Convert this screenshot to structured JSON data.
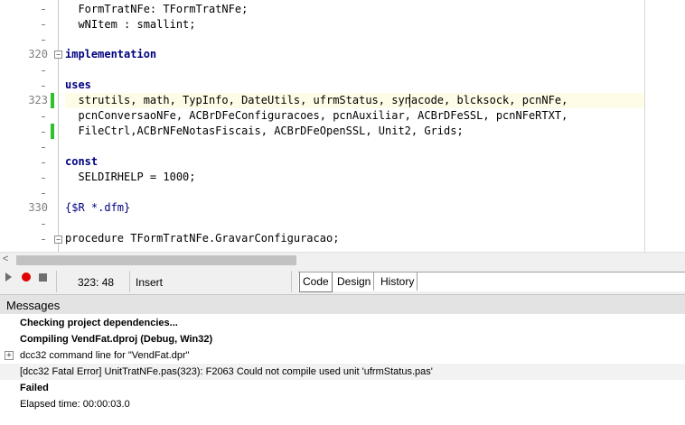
{
  "editor": {
    "lines": [
      {
        "num": "",
        "text": "  FormTratNFe: TFormTratNFe;"
      },
      {
        "num": "",
        "text": "  wNItem : smallint;"
      },
      {
        "num": "",
        "text": ""
      },
      {
        "num": "320",
        "text": "implementation"
      },
      {
        "num": "",
        "text": ""
      },
      {
        "num": "",
        "text": "uses"
      },
      {
        "num": "323",
        "text": "  strutils, math, TypInfo, DateUtils, ufrmStatus, synacode, blcksock, pcnNFe,"
      },
      {
        "num": "",
        "text": "  pcnConversaoNFe, ACBrDFeConfiguracoes, pcnAuxiliar, ACBrDFeSSL, pcnNFeRTXT,"
      },
      {
        "num": "",
        "text": "  FileCtrl,ACBrNFeNotasFiscais, ACBrDFeOpenSSL, Unit2, Grids;"
      },
      {
        "num": "",
        "text": ""
      },
      {
        "num": "",
        "text": "const"
      },
      {
        "num": "",
        "text": "  SELDIRHELP = 1000;"
      },
      {
        "num": "",
        "text": ""
      },
      {
        "num": "330",
        "text": "{$R *.dfm}"
      },
      {
        "num": "",
        "text": ""
      },
      {
        "num": "",
        "text": "procedure TFormTratNFe.GravarConfiguracao;"
      }
    ]
  },
  "status": {
    "position": "323:  48",
    "mode": "Insert"
  },
  "view_tabs": [
    "Code",
    "Design",
    "History"
  ],
  "messages": {
    "title": "Messages",
    "items": [
      {
        "text": "Checking project dependencies...",
        "bold": true
      },
      {
        "text": "Compiling VendFat.dproj (Debug, Win32)",
        "bold": true
      },
      {
        "text": "dcc32 command line for \"VendFat.dpr\"",
        "bold": false
      },
      {
        "text": "[dcc32 Fatal Error] UnitTratNFe.pas(323): F2063 Could not compile used unit 'ufrmStatus.pas'",
        "bold": false
      },
      {
        "text": "Failed",
        "bold": true
      },
      {
        "text": "Elapsed time: 00:00:03.0",
        "bold": false
      }
    ]
  }
}
